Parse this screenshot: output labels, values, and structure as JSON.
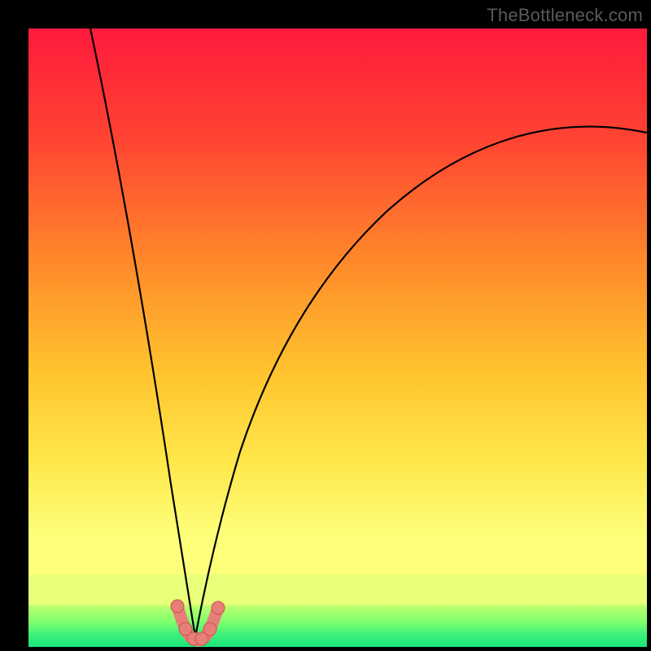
{
  "watermark": "TheBottleneck.com",
  "colors": {
    "bg": "#000000",
    "grad_top": "#ff1a3c",
    "grad_mid1": "#ff6a2a",
    "grad_mid2": "#ffc22e",
    "grad_mid3": "#ffe74a",
    "grad_mid4": "#fdff7a",
    "grad_band": "#e9ff7a",
    "grad_green1": "#7fff6e",
    "grad_green2": "#18e57a",
    "curve": "#000000",
    "marker_fill": "#e77f78",
    "marker_stroke": "#c9554e"
  },
  "chart_data": {
    "type": "line",
    "title": "",
    "xlabel": "",
    "ylabel": "",
    "x_range": [
      0,
      100
    ],
    "y_range": [
      0,
      100
    ],
    "optimum_x": 27,
    "curve_left": {
      "x": [
        10,
        13,
        16,
        19,
        22,
        24,
        25.5,
        27
      ],
      "y": [
        100,
        82,
        64,
        46,
        28,
        14,
        6,
        1.5
      ]
    },
    "curve_right": {
      "x": [
        27,
        29,
        32,
        36,
        42,
        50,
        60,
        72,
        86,
        100
      ],
      "y": [
        1.5,
        7,
        18,
        32,
        46,
        58,
        67,
        74,
        79,
        83
      ]
    },
    "valley_segment": {
      "x": [
        24.5,
        25.5,
        26.5,
        27.5,
        28.5,
        29.5,
        30.5
      ],
      "y": [
        6.5,
        3.5,
        2.0,
        1.5,
        2.0,
        3.5,
        6.0
      ]
    },
    "markers": [
      {
        "x": 24.5,
        "y": 6.5
      },
      {
        "x": 25.5,
        "y": 3.5
      },
      {
        "x": 26.5,
        "y": 2.0
      },
      {
        "x": 27.5,
        "y": 1.5
      },
      {
        "x": 28.5,
        "y": 2.0
      },
      {
        "x": 29.5,
        "y": 3.5
      },
      {
        "x": 30.5,
        "y": 6.0
      }
    ]
  }
}
